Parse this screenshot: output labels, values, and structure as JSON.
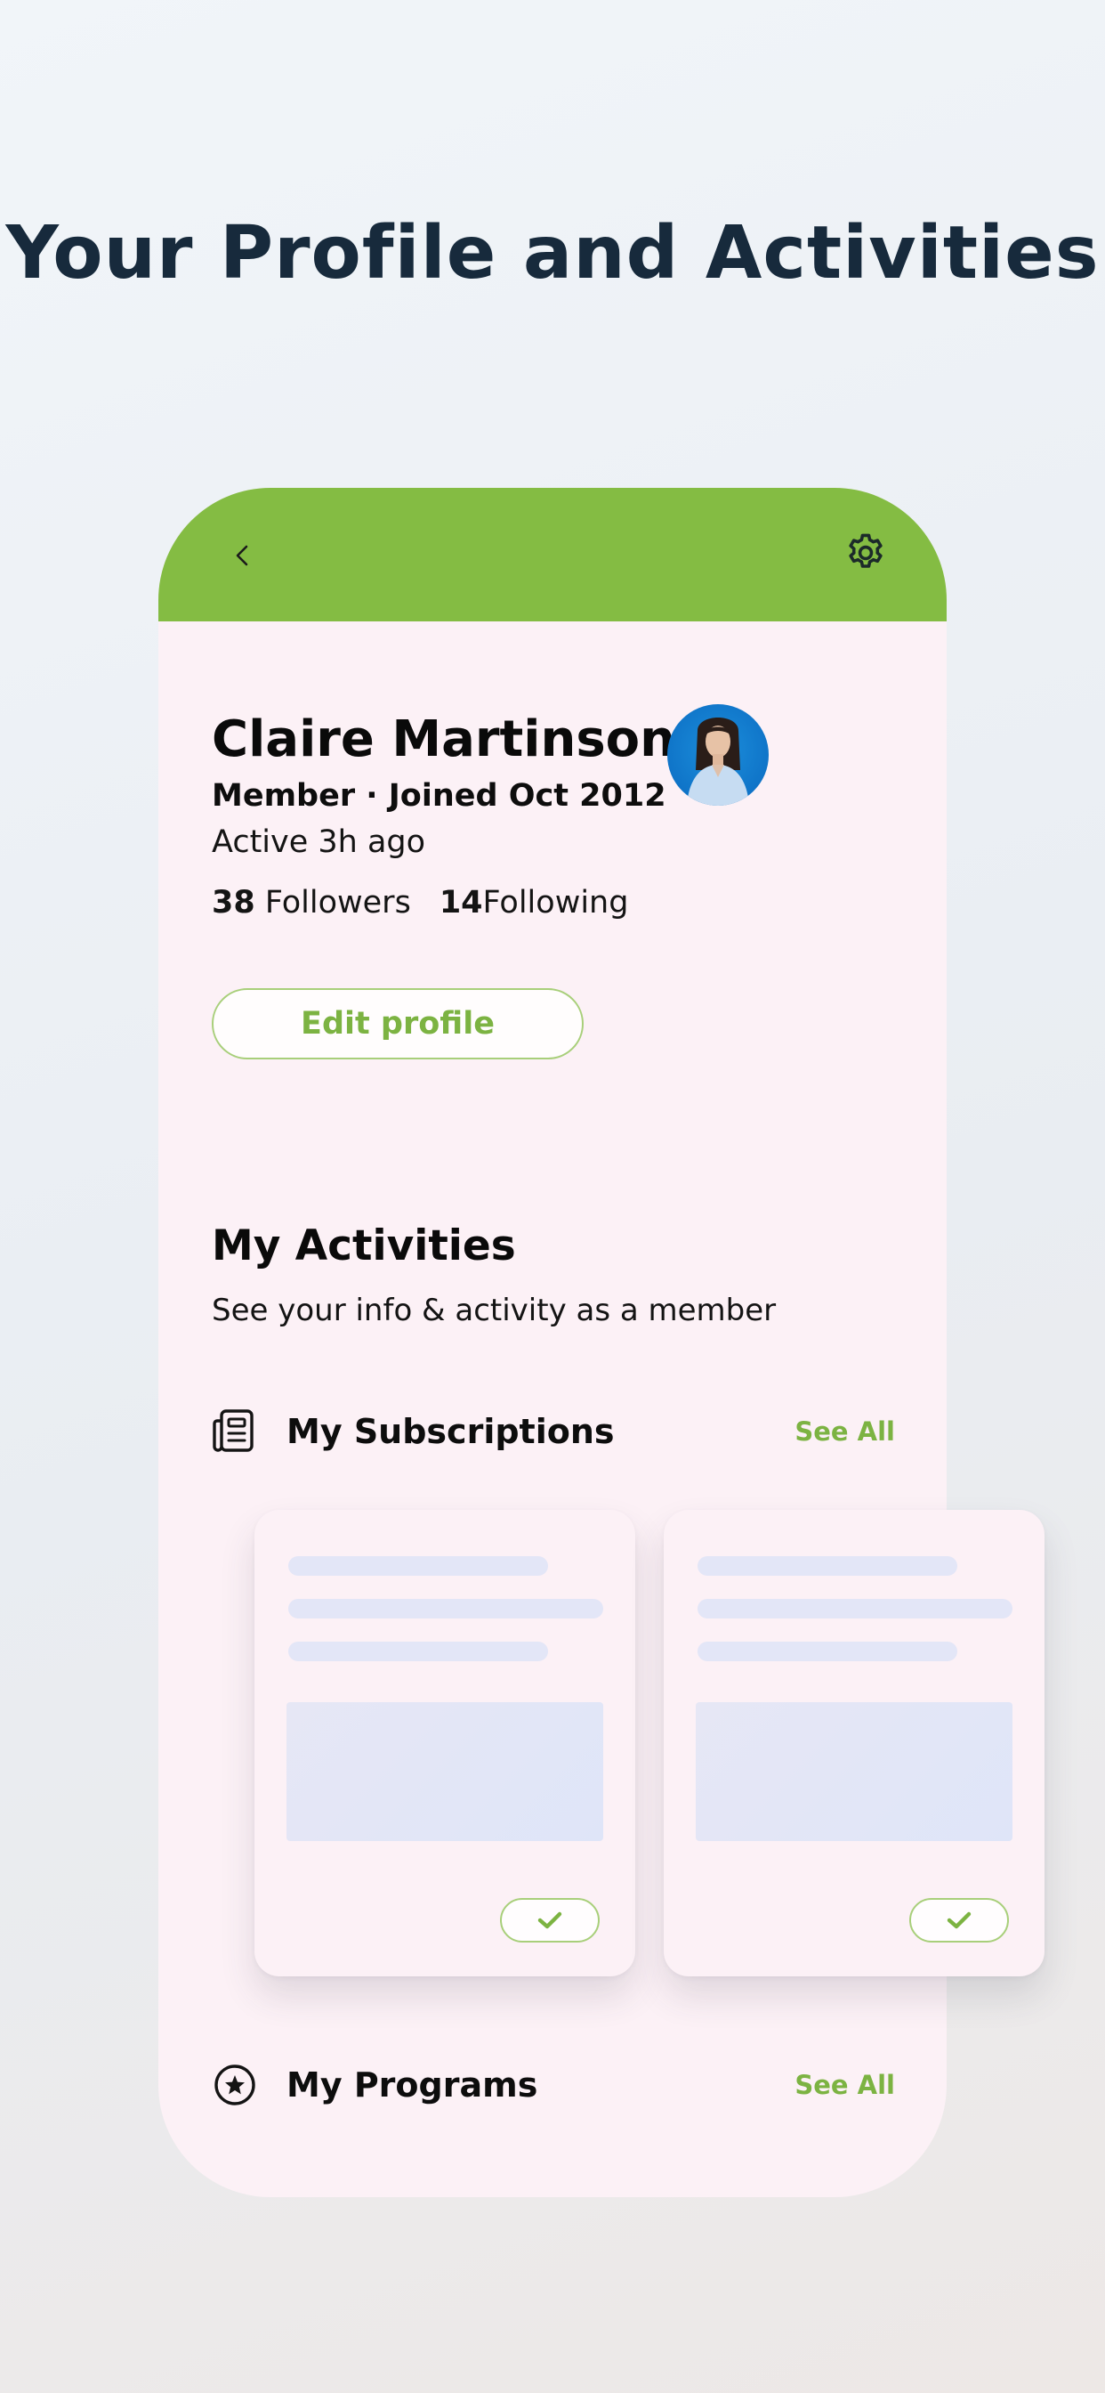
{
  "page": {
    "headline": "Your Profile and Activities"
  },
  "colors": {
    "accent": "#84bc43",
    "accent_text": "#7cb342",
    "phone_background": "#fcf1f6",
    "headline": "#172a3c"
  },
  "header": {
    "back_icon": "chevron-left-icon",
    "settings_icon": "gear-icon"
  },
  "profile": {
    "name": "Claire Martinson",
    "membership": "Member · Joined Oct 2012",
    "last_active": "Active 3h ago",
    "followers_count": "38",
    "followers_label": "Followers",
    "following_count": "14",
    "following_label": "Following",
    "edit_button": "Edit profile"
  },
  "activities": {
    "title": "My Activities",
    "subtitle": "See your info & activity as a member"
  },
  "subscriptions": {
    "icon": "newspaper-icon",
    "title": "My Subscriptions",
    "see_all": "See All",
    "cards": [
      {
        "check_icon": "check-icon"
      },
      {
        "check_icon": "check-icon"
      }
    ]
  },
  "programs": {
    "icon": "star-circle-icon",
    "title": "My Programs",
    "see_all": "See All"
  }
}
